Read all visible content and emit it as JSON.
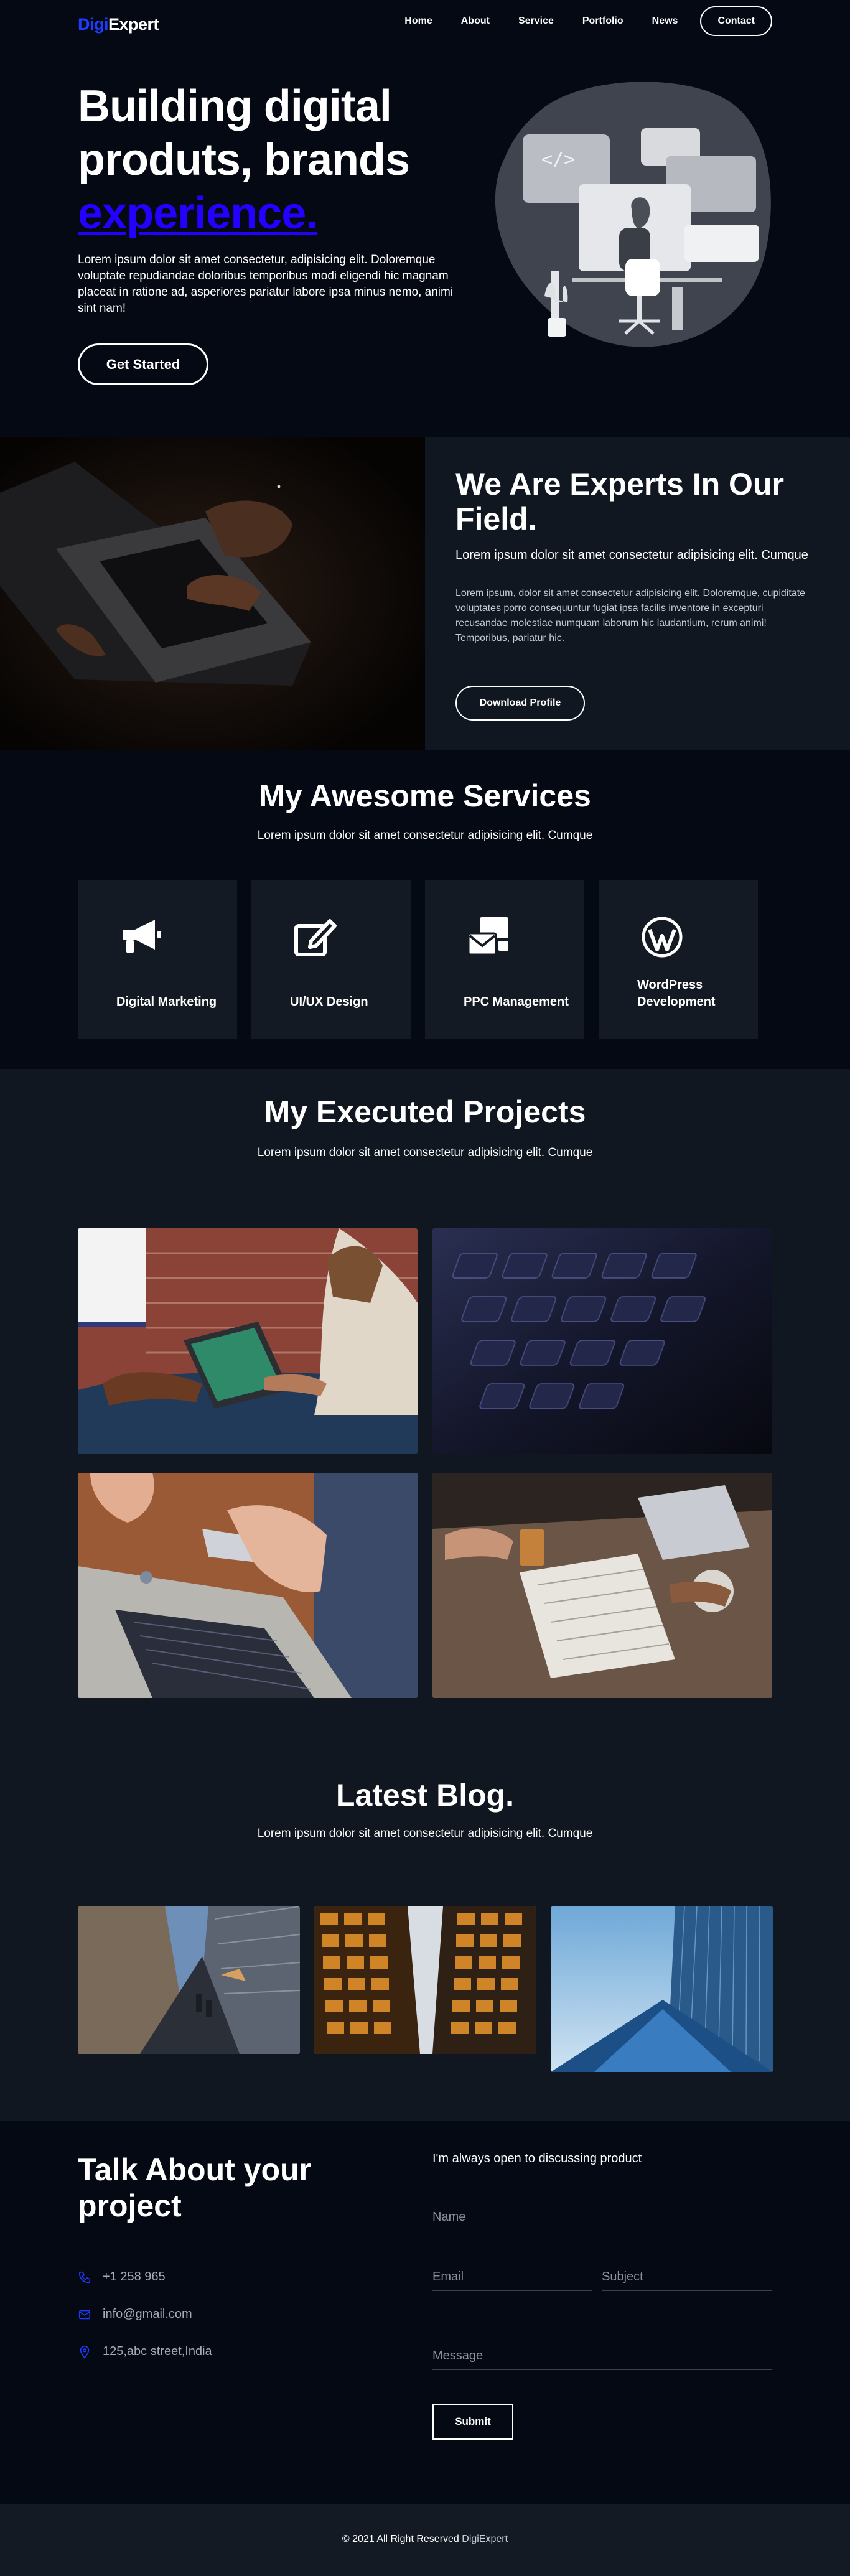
{
  "nav": {
    "logo_part1": "Digi",
    "logo_part2": "Expert",
    "links": [
      "Home",
      "About",
      "Service",
      "Portfolio",
      "News"
    ],
    "contact_button": "Contact"
  },
  "hero": {
    "title_line1": "Building digital",
    "title_line2": "produts, brands",
    "title_highlight": "experience.",
    "description": "Lorem ipsum dolor sit amet consectetur, adipisicing elit. Doloremque voluptate repudiandae doloribus temporibus modi eligendi hic magnam placeat in ratione ad, asperiores pariatur labore ipsa minus nemo, animi sint nam!",
    "button": "Get Started"
  },
  "experts": {
    "title": "We Are Experts In Our Field.",
    "subtitle": "Lorem ipsum dolor sit amet consectetur adipisicing elit. Cumque",
    "body": "Lorem ipsum, dolor sit amet consectetur adipisicing elit. Doloremque, cupiditate voluptates porro consequuntur fugiat ipsa facilis inventore in excepturi recusandae molestiae numquam laborum hic laudantium, rerum animi! Temporibus, pariatur hic.",
    "button": "Download Profile"
  },
  "services": {
    "title": "My Awesome Services",
    "subtitle": "Lorem ipsum dolor sit amet consectetur adipisicing elit. Cumque",
    "cards": [
      {
        "label": "Digital Marketing",
        "icon": "megaphone-icon"
      },
      {
        "label": "UI/UX Design",
        "icon": "edit-icon"
      },
      {
        "label": "PPC Management",
        "icon": "mail-bulk-icon"
      },
      {
        "label": "WordPress Development",
        "icon": "wordpress-icon"
      }
    ]
  },
  "projects": {
    "title": "My Executed Projects",
    "subtitle": "Lorem ipsum dolor sit amet consectetur adipisicing elit. Cumque"
  },
  "blog": {
    "title": "Latest Blog.",
    "subtitle": "Lorem ipsum dolor sit amet consectetur adipisicing elit. Cumque"
  },
  "contact": {
    "title": "Talk About your project",
    "phone": "+1 258 965",
    "email": "info@gmail.com",
    "address": "125,abc street,India",
    "lead": "I'm always open to discussing product",
    "name_placeholder": "Name",
    "email_placeholder": "Email",
    "subject_placeholder": "Subject",
    "message_placeholder": "Message",
    "submit": "Submit"
  },
  "footer": {
    "copyright": "© 2021 All Right Reserved",
    "brand": "DigiExpert"
  },
  "colors": {
    "background": "#050914",
    "panel": "#111720",
    "card": "#141a23",
    "accent": "#1f3bff",
    "highlight": "#2400ff"
  }
}
